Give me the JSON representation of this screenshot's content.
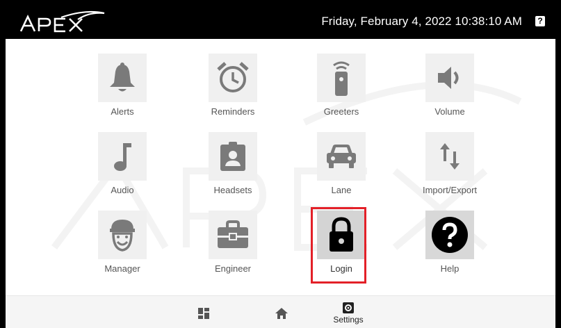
{
  "header": {
    "logo_text": "APEX",
    "datetime": "Friday, February 4, 2022 10:38:10 AM",
    "help_glyph": "?",
    "help_icon": "question-icon"
  },
  "watermark_text": "APEX",
  "menu": {
    "items": [
      {
        "label": "Alerts",
        "icon": "bell-icon"
      },
      {
        "label": "Reminders",
        "icon": "alarm-clock-icon"
      },
      {
        "label": "Greeters",
        "icon": "remote-icon"
      },
      {
        "label": "Volume",
        "icon": "speaker-icon"
      },
      {
        "label": "Audio",
        "icon": "music-note-icon"
      },
      {
        "label": "Headsets",
        "icon": "badge-icon"
      },
      {
        "label": "Lane",
        "icon": "car-icon"
      },
      {
        "label": "Import/Export",
        "icon": "import-export-icon"
      },
      {
        "label": "Manager",
        "icon": "manager-icon"
      },
      {
        "label": "Engineer",
        "icon": "toolbox-icon"
      },
      {
        "label": "Login",
        "icon": "lock-icon",
        "selected": true
      },
      {
        "label": "Help",
        "icon": "help-circle-icon"
      }
    ]
  },
  "bottom_nav": {
    "dashboard_icon": "dashboard-icon",
    "home_icon": "home-icon",
    "settings_icon": "settings-icon",
    "settings_label": "Settings"
  },
  "colors": {
    "highlight": "#e32028",
    "icon_gray": "#7a7a7a",
    "tile_bg": "#f0f0f0"
  }
}
